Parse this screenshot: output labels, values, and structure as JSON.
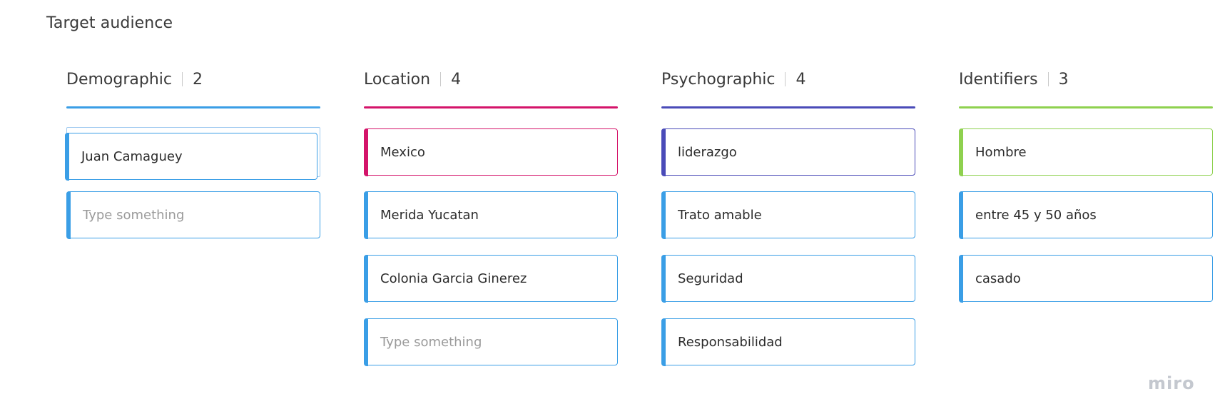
{
  "board": {
    "title": "Target audience"
  },
  "colors": {
    "default_card_border": "#3a9ee6",
    "placeholder_text": "#9a9a9a"
  },
  "columns": [
    {
      "name": "Demographic",
      "count": "2",
      "accent": "#3a9ee6",
      "cards": [
        {
          "text": "Juan Camaguey",
          "placeholder": false,
          "accent": "#3a9ee6",
          "border": "#3a9ee6"
        },
        {
          "text": "Type something",
          "placeholder": true,
          "accent": "#3a9ee6",
          "border": "#3a9ee6"
        }
      ]
    },
    {
      "name": "Location",
      "count": "4",
      "accent": "#d4146a",
      "cards": [
        {
          "text": "Mexico",
          "placeholder": false,
          "accent": "#d4146a",
          "border": "#d4146a"
        },
        {
          "text": "Merida Yucatan",
          "placeholder": false,
          "accent": "#3a9ee6",
          "border": "#3a9ee6"
        },
        {
          "text": "Colonia Garcia Ginerez",
          "placeholder": false,
          "accent": "#3a9ee6",
          "border": "#3a9ee6"
        },
        {
          "text": "Type something",
          "placeholder": true,
          "accent": "#3a9ee6",
          "border": "#3a9ee6"
        }
      ]
    },
    {
      "name": "Psychographic",
      "count": "4",
      "accent": "#4a4bb8",
      "cards": [
        {
          "text": "liderazgo",
          "placeholder": false,
          "accent": "#4a4bb8",
          "border": "#4a4bb8"
        },
        {
          "text": "Trato amable",
          "placeholder": false,
          "accent": "#3a9ee6",
          "border": "#3a9ee6"
        },
        {
          "text": "Seguridad",
          "placeholder": false,
          "accent": "#3a9ee6",
          "border": "#3a9ee6"
        },
        {
          "text": "Responsabilidad",
          "placeholder": false,
          "accent": "#3a9ee6",
          "border": "#3a9ee6"
        }
      ]
    },
    {
      "name": "Identifiers",
      "count": "3",
      "accent": "#8fd14f",
      "cards": [
        {
          "text": "Hombre",
          "placeholder": false,
          "accent": "#8fd14f",
          "border": "#8fd14f"
        },
        {
          "text": "entre 45 y 50 años",
          "placeholder": false,
          "accent": "#3a9ee6",
          "border": "#3a9ee6"
        },
        {
          "text": "casado",
          "placeholder": false,
          "accent": "#3a9ee6",
          "border": "#3a9ee6"
        }
      ]
    }
  ],
  "branding": {
    "logo_text": "miro"
  }
}
